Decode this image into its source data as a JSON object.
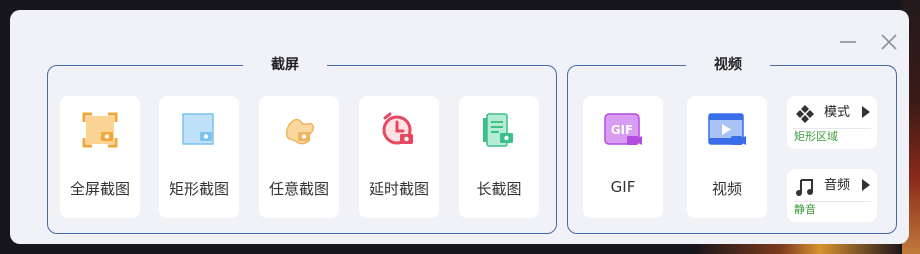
{
  "window": {
    "minimize_icon": "minimize-icon",
    "close_icon": "close-icon"
  },
  "screenshot_group": {
    "title": "截屏",
    "items": [
      {
        "label": "全屏截图",
        "icon": "fullscreen-capture-icon",
        "color": "#f3a63b"
      },
      {
        "label": "矩形截图",
        "icon": "rectangle-capture-icon",
        "color": "#7cc3f0"
      },
      {
        "label": "任意截图",
        "icon": "freeform-capture-icon",
        "color": "#f0b45e"
      },
      {
        "label": "延时截图",
        "icon": "timer-capture-icon",
        "color": "#e8485e"
      },
      {
        "label": "长截图",
        "icon": "scroll-capture-icon",
        "color": "#3cc08a"
      }
    ]
  },
  "video_group": {
    "title": "视频",
    "items": [
      {
        "label": "GIF",
        "icon": "gif-record-icon",
        "color": "#b44ce0"
      },
      {
        "label": "视频",
        "icon": "video-record-icon",
        "color": "#3a6ee8"
      }
    ],
    "mode": {
      "title": "模式",
      "value": "矩形区域",
      "value_color": "#3a9a3a"
    },
    "audio": {
      "title": "音频",
      "value": "静音",
      "value_color": "#3a9a3a"
    }
  }
}
